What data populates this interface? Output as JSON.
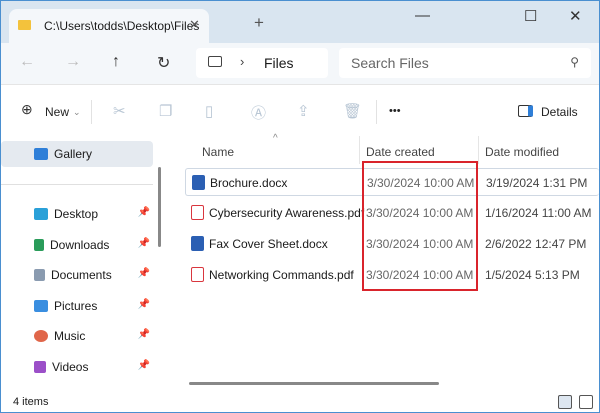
{
  "window": {
    "tab_title": "C:\\Users\\todds\\Desktop\\Files",
    "new_tab": "+",
    "minimize": "—",
    "maximize": "☐",
    "close": "✕"
  },
  "nav": {
    "back": "←",
    "forward": "→",
    "up": "↑",
    "refresh": "↻",
    "breadcrumb_sep": "›",
    "breadcrumb": "Files",
    "search_placeholder": "Search Files"
  },
  "toolbar": {
    "new_label": "New",
    "more": "•••",
    "details_label": "Details"
  },
  "sidebar": {
    "items": [
      {
        "label": "Gallery",
        "color": "#2f7fd8",
        "selected": true
      },
      {
        "label": "Desktop",
        "color": "#2aa0d8"
      },
      {
        "label": "Downloads",
        "color": "#2a9c5a"
      },
      {
        "label": "Documents",
        "color": "#8a9bb0"
      },
      {
        "label": "Pictures",
        "color": "#3a8ee0"
      },
      {
        "label": "Music",
        "color": "#e0664a"
      },
      {
        "label": "Videos",
        "color": "#9b4fc8"
      }
    ]
  },
  "columns": {
    "name": "Name",
    "date_created": "Date created",
    "date_modified": "Date modified"
  },
  "files": [
    {
      "name": "Brochure.docx",
      "type": "word",
      "created": "3/30/2024 10:00 AM",
      "modified": "3/19/2024 1:31 PM"
    },
    {
      "name": "Cybersecurity Awareness.pdf",
      "type": "pdf",
      "created": "3/30/2024 10:00 AM",
      "modified": "1/16/2024 11:00 AM"
    },
    {
      "name": "Fax Cover Sheet.docx",
      "type": "word",
      "created": "3/30/2024 10:00 AM",
      "modified": "2/6/2022 12:47 PM"
    },
    {
      "name": "Networking Commands.pdf",
      "type": "pdf",
      "created": "3/30/2024 10:00 AM",
      "modified": "1/5/2024 5:13 PM"
    }
  ],
  "status": {
    "count": "4 items"
  },
  "colors": {
    "highlight": "#d9242c",
    "word": "#2b5fb3",
    "pdf": "#d9363e"
  }
}
